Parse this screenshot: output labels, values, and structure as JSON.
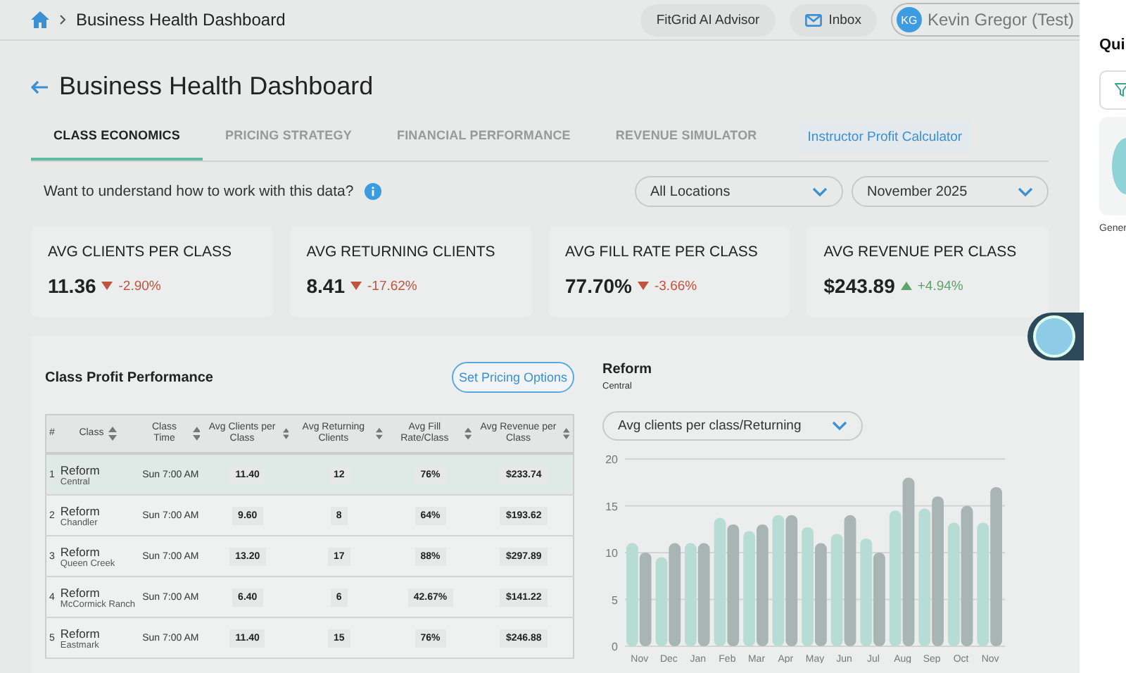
{
  "header": {
    "breadcrumb": "Business Health Dashboard",
    "buttons": [
      {
        "kind": "plain",
        "label": "FitGrid AI Advisor"
      },
      {
        "kind": "mail",
        "label": "Inbox"
      }
    ],
    "user": {
      "initials": "KG",
      "name": "Kevin Gregor (Test)"
    }
  },
  "page": {
    "title": "Business Health Dashboard"
  },
  "tabs": [
    {
      "kind": "tab",
      "label": "CLASS ECONOMICS",
      "selected": true
    },
    {
      "kind": "tab",
      "label": "PRICING STRATEGY",
      "selected": false
    },
    {
      "kind": "tab",
      "label": "FINANCIAL PERFORMANCE",
      "selected": false
    },
    {
      "kind": "tab",
      "label": "REVENUE SIMULATOR",
      "selected": false
    },
    {
      "kind": "button",
      "label": "Instructor Profit Calculator",
      "selected": false
    }
  ],
  "help_text": "Want to understand how to work with this data?",
  "filters": [
    {
      "value": "All Locations"
    },
    {
      "value": "November 2025"
    }
  ],
  "kpis": [
    {
      "label": "AVG CLIENTS PER CLASS",
      "value": "11.36",
      "kind": "down",
      "change": "-2.90%"
    },
    {
      "label": "AVG RETURNING CLIENTS",
      "value": "8.41",
      "kind": "down",
      "change": "-17.62%"
    },
    {
      "label": "AVG FILL RATE PER CLASS",
      "value": "77.70%",
      "kind": "down",
      "change": "-3.66%"
    },
    {
      "label": "AVG REVENUE PER CLASS",
      "value": "$243.89",
      "kind": "up",
      "change": "+4.94%"
    }
  ],
  "table_card": {
    "title": "Class Profit Performance",
    "button": "Set Pricing Options"
  },
  "table": {
    "columns": [
      {
        "label": "#",
        "sortable": false
      },
      {
        "label": "Class",
        "sortable": true
      },
      {
        "label": "Class Time",
        "sortable": true
      },
      {
        "label": "Avg Clients per Class",
        "sortable": true
      },
      {
        "label": "Avg Returning Clients",
        "sortable": true
      },
      {
        "label": "Avg Fill Rate/Class",
        "sortable": true
      },
      {
        "label": "Avg Revenue per Class",
        "sortable": true
      }
    ],
    "rows": [
      {
        "selected": true,
        "number": "1",
        "class": "Reform",
        "location": "Central",
        "time": "Sun 7:00 AM",
        "values": [
          "11.40",
          "12",
          "76%",
          "$233.74"
        ]
      },
      {
        "selected": false,
        "number": "2",
        "class": "Reform",
        "location": "Chandler",
        "time": "Sun 7:00 AM",
        "values": [
          "9.60",
          "8",
          "64%",
          "$193.62"
        ]
      },
      {
        "selected": false,
        "number": "3",
        "class": "Reform",
        "location": "Queen Creek",
        "time": "Sun 7:00 AM",
        "values": [
          "13.20",
          "17",
          "88%",
          "$297.89"
        ]
      },
      {
        "selected": false,
        "number": "4",
        "class": "Reform",
        "location": "McCormick Ranch",
        "time": "Sun 7:00 AM",
        "values": [
          "6.40",
          "6",
          "42.67%",
          "$141.22"
        ]
      },
      {
        "selected": false,
        "number": "5",
        "class": "Reform",
        "location": "Eastmark",
        "time": "Sun 7:00 AM",
        "values": [
          "11.40",
          "15",
          "76%",
          "$246.88"
        ]
      }
    ]
  },
  "detail": {
    "title": "Reform",
    "subtitle": "Central",
    "metric": "Avg clients per class/Returning",
    "chart_data": {
      "type": "bar",
      "categories": [
        "Nov",
        "Dec",
        "Jan",
        "Feb",
        "Mar",
        "Apr",
        "May",
        "Jun",
        "Jul",
        "Aug",
        "Sep",
        "Oct",
        "Nov"
      ],
      "series": [
        {
          "color": "#b7dcd3",
          "values": [
            11,
            9.5,
            11,
            13.7,
            12.3,
            14,
            12.7,
            12,
            11.5,
            14.5,
            14.7,
            13.2,
            13.2
          ]
        },
        {
          "color": "#a9b5b3",
          "values": [
            10,
            11,
            11,
            13,
            13,
            14,
            11,
            14,
            10,
            18,
            16,
            15,
            17
          ]
        }
      ],
      "ylim": [
        0,
        20
      ],
      "yticks": [
        0,
        5,
        10,
        15,
        20
      ],
      "grid": true
    }
  },
  "side_panel": {
    "title": "Qui",
    "caption": "Gener"
  }
}
